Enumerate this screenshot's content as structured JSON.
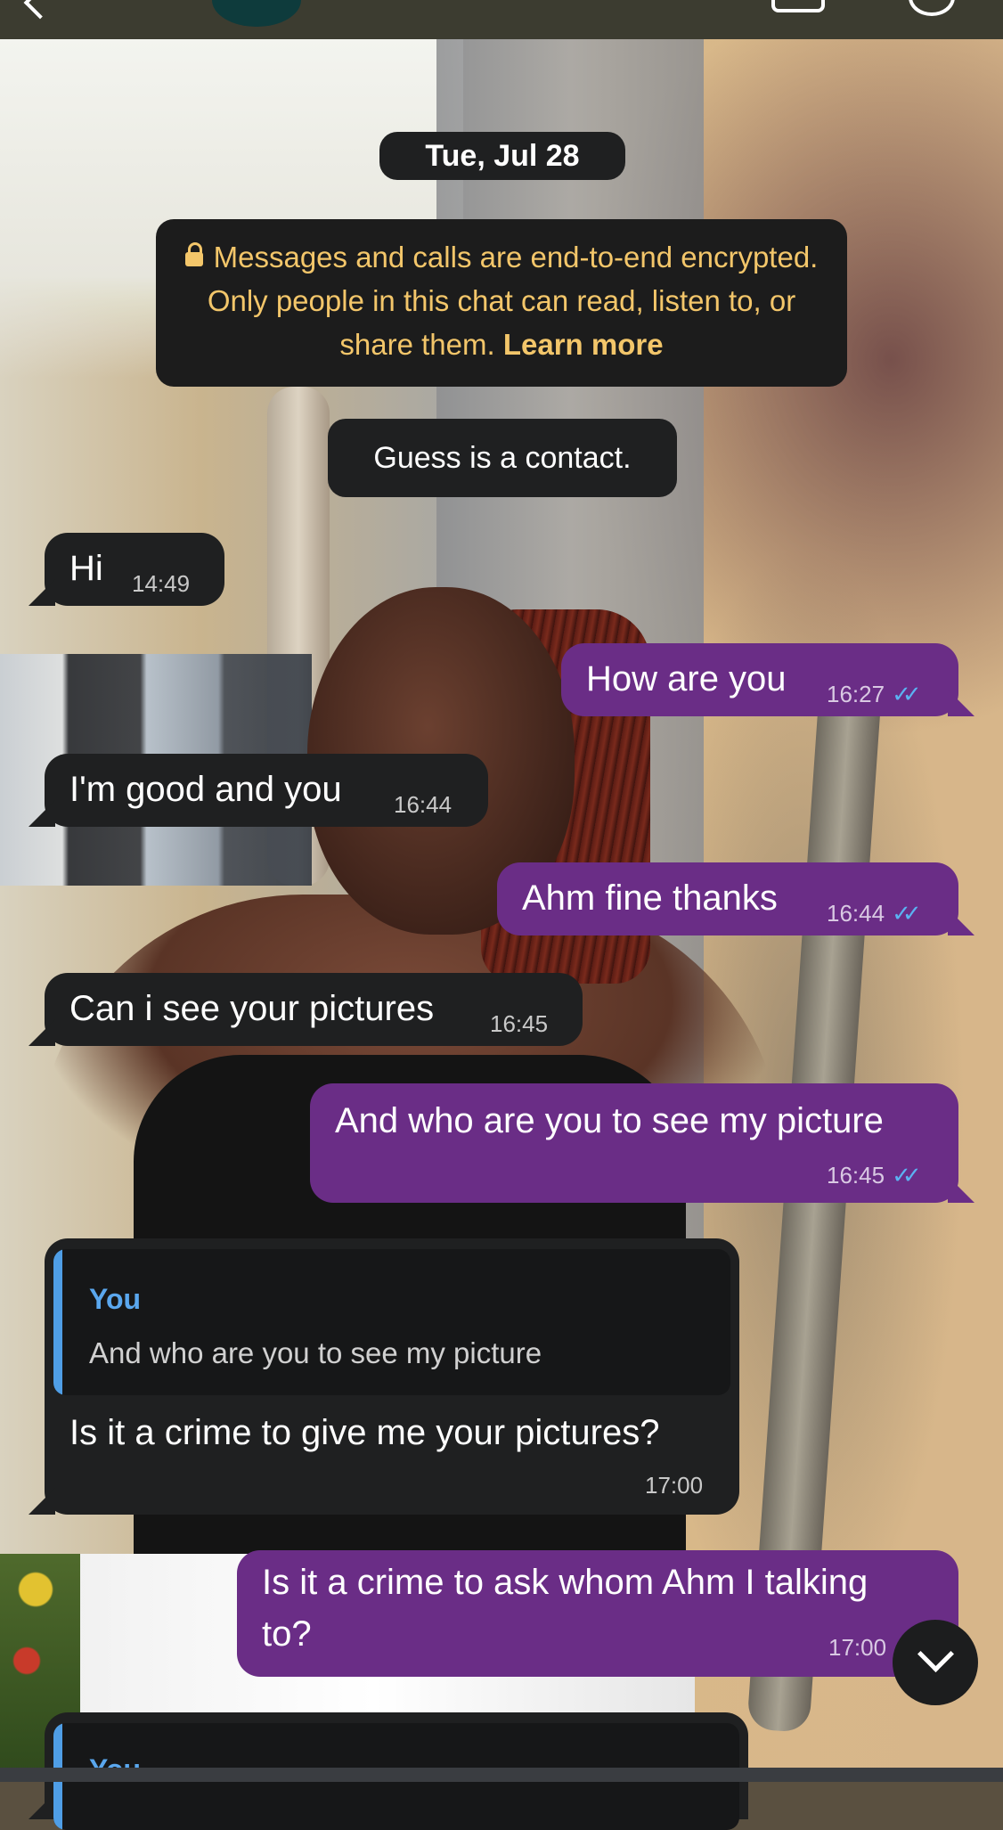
{
  "header": {
    "back_icon": "back-arrow-icon",
    "avatar_color": "#0e3b3c",
    "video_icon": "video-call-icon",
    "call_icon": "phone-call-icon"
  },
  "chat": {
    "date": "Tue, Jul 28",
    "encryption_notice": {
      "text": "Messages and calls are end-to-end encrypted. Only people in this chat can read, listen to, or share them.",
      "link": "Learn more",
      "icon": "lock-icon",
      "color": "#f3c66a"
    },
    "system_message": "Guess is a contact.",
    "messages": [
      {
        "direction": "in",
        "text": "Hi",
        "time": "14:49"
      },
      {
        "direction": "out",
        "text": "How are you",
        "time": "16:27",
        "ticks": "read"
      },
      {
        "direction": "in",
        "text": "I'm good and you",
        "time": "16:44"
      },
      {
        "direction": "out",
        "text": "Ahm fine thanks",
        "time": "16:44",
        "ticks": "read"
      },
      {
        "direction": "in",
        "text": "Can i see your pictures",
        "time": "16:45"
      },
      {
        "direction": "out",
        "text": "And who are you to see my picture",
        "time": "16:45",
        "ticks": "read"
      },
      {
        "direction": "in",
        "text": "Is it a crime to give me your pictures?",
        "time": "17:00",
        "reply": {
          "author": "You",
          "text": "And who are you to see my picture"
        }
      },
      {
        "direction": "out",
        "text_line1": "Is it a crime to ask whom Ahm I talking",
        "text_line2": "to?",
        "time": "17:00"
      },
      {
        "direction": "in",
        "reply": {
          "author": "You"
        }
      }
    ],
    "tick_glyph": "✓✓"
  },
  "colors": {
    "incoming_bubble": "#1f2021",
    "outgoing_bubble": "#6a2d86",
    "read_ticks": "#5bb2f2",
    "reply_accent": "#4f9ee6"
  },
  "scroll_button_icon": "chevron-down-icon"
}
